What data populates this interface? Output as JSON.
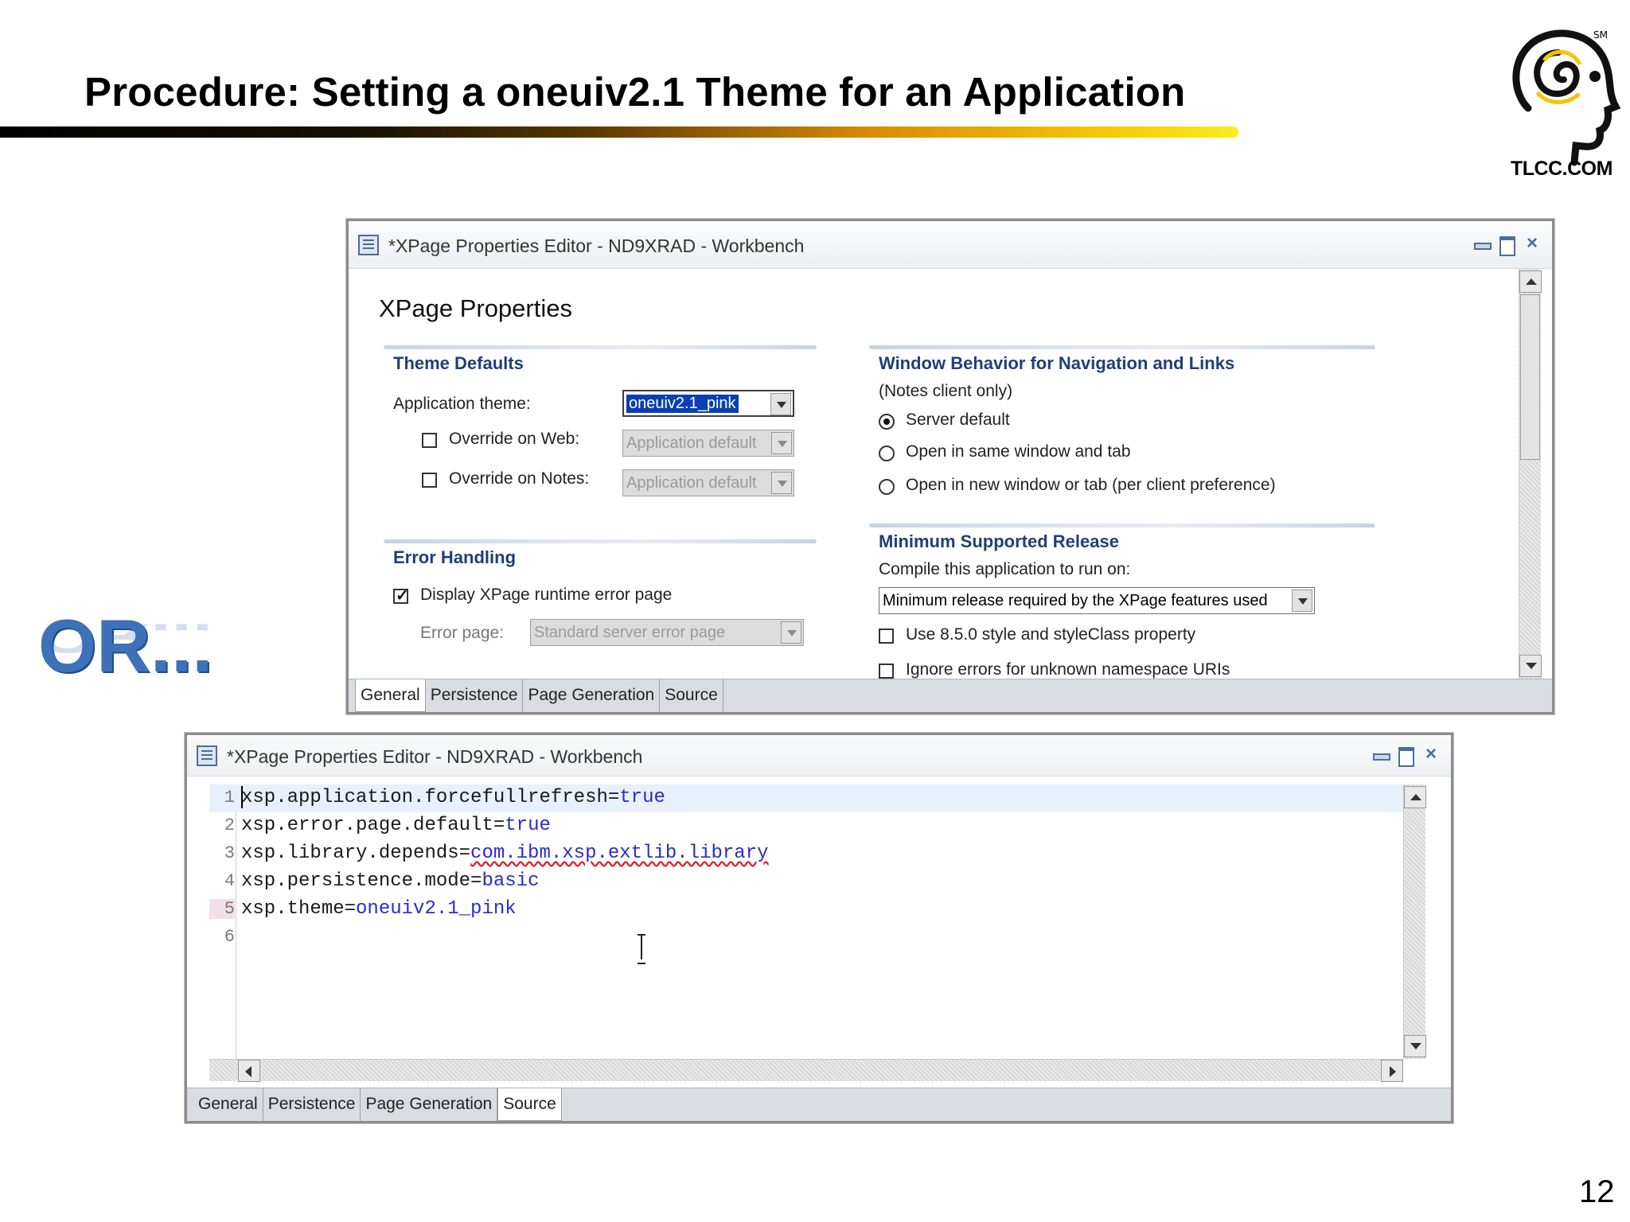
{
  "slide": {
    "title": "Procedure: Setting a oneuiv2.1 Theme for an Application",
    "logo_text": "TLCC.COM",
    "logo_mark": "SM",
    "or_text": "OR...",
    "page_number": "12"
  },
  "colors": {
    "section_heading": "#1f3f77",
    "code_value": "#2b2bd0",
    "or_text": "#3d72b8",
    "selection": "#0a3fb1"
  },
  "window1": {
    "title": "*XPage Properties Editor - ND9XRAD - Workbench",
    "heading": "XPage Properties",
    "theme_defaults": {
      "heading": "Theme Defaults",
      "app_theme_label": "Application theme:",
      "app_theme_value": "oneuiv2.1_pink",
      "override_web_label": "Override on Web:",
      "override_web_value": "Application default",
      "override_web_checked": false,
      "override_notes_label": "Override on Notes:",
      "override_notes_value": "Application default",
      "override_notes_checked": false
    },
    "error_handling": {
      "heading": "Error Handling",
      "display_error_label": "Display XPage runtime error page",
      "display_error_checked": true,
      "error_page_label": "Error page:",
      "error_page_value": "Standard server error page"
    },
    "window_behavior": {
      "heading": "Window Behavior for Navigation and Links",
      "note": "(Notes client only)",
      "options": [
        {
          "label": "Server default",
          "selected": true
        },
        {
          "label": "Open in same window and tab",
          "selected": false
        },
        {
          "label": "Open in new window or tab (per client preference)",
          "selected": false
        }
      ]
    },
    "min_release": {
      "heading": "Minimum Supported Release",
      "compile_label": "Compile this application to run on:",
      "compile_value": "Minimum release required by the XPage features used",
      "style_label": "Use 8.5.0 style and styleClass property",
      "ignore_label": "Ignore errors for unknown namespace URIs"
    },
    "tabs": [
      "General",
      "Persistence",
      "Page Generation",
      "Source"
    ],
    "active_tab": "General"
  },
  "window2": {
    "title": "*XPage Properties Editor - ND9XRAD - Workbench",
    "lines": [
      {
        "num": "1",
        "key": "xsp.application.forcefullrefresh=",
        "value": "true"
      },
      {
        "num": "2",
        "key": "xsp.error.page.default=",
        "value": "true"
      },
      {
        "num": "3",
        "key": "xsp.library.depends=",
        "value": "com.ibm.xsp.extlib.library"
      },
      {
        "num": "4",
        "key": "xsp.persistence.mode=",
        "value": "basic"
      },
      {
        "num": "5",
        "key": "xsp.theme=",
        "value": "oneuiv2.1_pink"
      },
      {
        "num": "6",
        "key": "",
        "value": ""
      }
    ],
    "tabs": [
      "General",
      "Persistence",
      "Page Generation",
      "Source"
    ],
    "active_tab": "Source"
  }
}
